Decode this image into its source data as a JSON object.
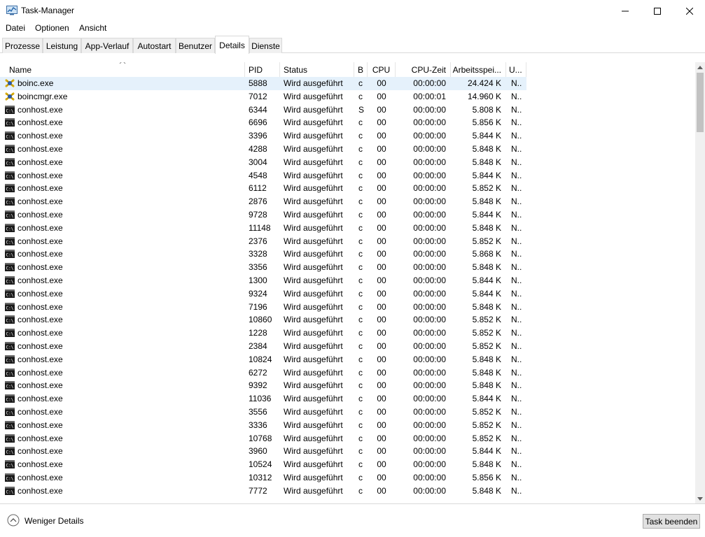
{
  "window": {
    "title": "Task-Manager",
    "icon": "task-manager-icon"
  },
  "menu": [
    "Datei",
    "Optionen",
    "Ansicht"
  ],
  "tabs": [
    {
      "label": "Prozesse",
      "active": false
    },
    {
      "label": "Leistung",
      "active": false
    },
    {
      "label": "App-Verlauf",
      "active": false
    },
    {
      "label": "Autostart",
      "active": false
    },
    {
      "label": "Benutzer",
      "active": false
    },
    {
      "label": "Details",
      "active": true
    },
    {
      "label": "Dienste",
      "active": false
    }
  ],
  "table": {
    "columns": [
      "Name",
      "PID",
      "Status",
      "B",
      "CPU",
      "CPU-Zeit",
      "Arbeitsspei...",
      "U..."
    ],
    "sorted_column": "Name",
    "rows": [
      {
        "icon": "boinc-icon",
        "name": "boinc.exe",
        "pid": "5888",
        "status": "Wird ausgeführt",
        "b": "c",
        "cpu": "00",
        "cputime": "00:00:00",
        "mem": "24.424 K",
        "u": "N..",
        "selected": true
      },
      {
        "icon": "boinc-icon",
        "name": "boincmgr.exe",
        "pid": "7012",
        "status": "Wird ausgeführt",
        "b": "c",
        "cpu": "00",
        "cputime": "00:00:01",
        "mem": "14.960 K",
        "u": "N.."
      },
      {
        "icon": "console-icon",
        "name": "conhost.exe",
        "pid": "6344",
        "status": "Wird ausgeführt",
        "b": "S",
        "cpu": "00",
        "cputime": "00:00:00",
        "mem": "5.808 K",
        "u": "N.."
      },
      {
        "icon": "console-icon",
        "name": "conhost.exe",
        "pid": "6696",
        "status": "Wird ausgeführt",
        "b": "c",
        "cpu": "00",
        "cputime": "00:00:00",
        "mem": "5.856 K",
        "u": "N.."
      },
      {
        "icon": "console-icon",
        "name": "conhost.exe",
        "pid": "3396",
        "status": "Wird ausgeführt",
        "b": "c",
        "cpu": "00",
        "cputime": "00:00:00",
        "mem": "5.844 K",
        "u": "N.."
      },
      {
        "icon": "console-icon",
        "name": "conhost.exe",
        "pid": "4288",
        "status": "Wird ausgeführt",
        "b": "c",
        "cpu": "00",
        "cputime": "00:00:00",
        "mem": "5.848 K",
        "u": "N.."
      },
      {
        "icon": "console-icon",
        "name": "conhost.exe",
        "pid": "3004",
        "status": "Wird ausgeführt",
        "b": "c",
        "cpu": "00",
        "cputime": "00:00:00",
        "mem": "5.848 K",
        "u": "N.."
      },
      {
        "icon": "console-icon",
        "name": "conhost.exe",
        "pid": "4548",
        "status": "Wird ausgeführt",
        "b": "c",
        "cpu": "00",
        "cputime": "00:00:00",
        "mem": "5.844 K",
        "u": "N.."
      },
      {
        "icon": "console-icon",
        "name": "conhost.exe",
        "pid": "6112",
        "status": "Wird ausgeführt",
        "b": "c",
        "cpu": "00",
        "cputime": "00:00:00",
        "mem": "5.852 K",
        "u": "N.."
      },
      {
        "icon": "console-icon",
        "name": "conhost.exe",
        "pid": "2876",
        "status": "Wird ausgeführt",
        "b": "c",
        "cpu": "00",
        "cputime": "00:00:00",
        "mem": "5.848 K",
        "u": "N.."
      },
      {
        "icon": "console-icon",
        "name": "conhost.exe",
        "pid": "9728",
        "status": "Wird ausgeführt",
        "b": "c",
        "cpu": "00",
        "cputime": "00:00:00",
        "mem": "5.844 K",
        "u": "N.."
      },
      {
        "icon": "console-icon",
        "name": "conhost.exe",
        "pid": "11148",
        "status": "Wird ausgeführt",
        "b": "c",
        "cpu": "00",
        "cputime": "00:00:00",
        "mem": "5.848 K",
        "u": "N.."
      },
      {
        "icon": "console-icon",
        "name": "conhost.exe",
        "pid": "2376",
        "status": "Wird ausgeführt",
        "b": "c",
        "cpu": "00",
        "cputime": "00:00:00",
        "mem": "5.852 K",
        "u": "N.."
      },
      {
        "icon": "console-icon",
        "name": "conhost.exe",
        "pid": "3328",
        "status": "Wird ausgeführt",
        "b": "c",
        "cpu": "00",
        "cputime": "00:00:00",
        "mem": "5.868 K",
        "u": "N.."
      },
      {
        "icon": "console-icon",
        "name": "conhost.exe",
        "pid": "3356",
        "status": "Wird ausgeführt",
        "b": "c",
        "cpu": "00",
        "cputime": "00:00:00",
        "mem": "5.848 K",
        "u": "N.."
      },
      {
        "icon": "console-icon",
        "name": "conhost.exe",
        "pid": "1300",
        "status": "Wird ausgeführt",
        "b": "c",
        "cpu": "00",
        "cputime": "00:00:00",
        "mem": "5.844 K",
        "u": "N.."
      },
      {
        "icon": "console-icon",
        "name": "conhost.exe",
        "pid": "9324",
        "status": "Wird ausgeführt",
        "b": "c",
        "cpu": "00",
        "cputime": "00:00:00",
        "mem": "5.844 K",
        "u": "N.."
      },
      {
        "icon": "console-icon",
        "name": "conhost.exe",
        "pid": "7196",
        "status": "Wird ausgeführt",
        "b": "c",
        "cpu": "00",
        "cputime": "00:00:00",
        "mem": "5.848 K",
        "u": "N.."
      },
      {
        "icon": "console-icon",
        "name": "conhost.exe",
        "pid": "10860",
        "status": "Wird ausgeführt",
        "b": "c",
        "cpu": "00",
        "cputime": "00:00:00",
        "mem": "5.852 K",
        "u": "N.."
      },
      {
        "icon": "console-icon",
        "name": "conhost.exe",
        "pid": "1228",
        "status": "Wird ausgeführt",
        "b": "c",
        "cpu": "00",
        "cputime": "00:00:00",
        "mem": "5.852 K",
        "u": "N.."
      },
      {
        "icon": "console-icon",
        "name": "conhost.exe",
        "pid": "2384",
        "status": "Wird ausgeführt",
        "b": "c",
        "cpu": "00",
        "cputime": "00:00:00",
        "mem": "5.852 K",
        "u": "N.."
      },
      {
        "icon": "console-icon",
        "name": "conhost.exe",
        "pid": "10824",
        "status": "Wird ausgeführt",
        "b": "c",
        "cpu": "00",
        "cputime": "00:00:00",
        "mem": "5.848 K",
        "u": "N.."
      },
      {
        "icon": "console-icon",
        "name": "conhost.exe",
        "pid": "6272",
        "status": "Wird ausgeführt",
        "b": "c",
        "cpu": "00",
        "cputime": "00:00:00",
        "mem": "5.848 K",
        "u": "N.."
      },
      {
        "icon": "console-icon",
        "name": "conhost.exe",
        "pid": "9392",
        "status": "Wird ausgeführt",
        "b": "c",
        "cpu": "00",
        "cputime": "00:00:00",
        "mem": "5.848 K",
        "u": "N.."
      },
      {
        "icon": "console-icon",
        "name": "conhost.exe",
        "pid": "11036",
        "status": "Wird ausgeführt",
        "b": "c",
        "cpu": "00",
        "cputime": "00:00:00",
        "mem": "5.844 K",
        "u": "N.."
      },
      {
        "icon": "console-icon",
        "name": "conhost.exe",
        "pid": "3556",
        "status": "Wird ausgeführt",
        "b": "c",
        "cpu": "00",
        "cputime": "00:00:00",
        "mem": "5.852 K",
        "u": "N.."
      },
      {
        "icon": "console-icon",
        "name": "conhost.exe",
        "pid": "3336",
        "status": "Wird ausgeführt",
        "b": "c",
        "cpu": "00",
        "cputime": "00:00:00",
        "mem": "5.852 K",
        "u": "N.."
      },
      {
        "icon": "console-icon",
        "name": "conhost.exe",
        "pid": "10768",
        "status": "Wird ausgeführt",
        "b": "c",
        "cpu": "00",
        "cputime": "00:00:00",
        "mem": "5.852 K",
        "u": "N.."
      },
      {
        "icon": "console-icon",
        "name": "conhost.exe",
        "pid": "3960",
        "status": "Wird ausgeführt",
        "b": "c",
        "cpu": "00",
        "cputime": "00:00:00",
        "mem": "5.844 K",
        "u": "N.."
      },
      {
        "icon": "console-icon",
        "name": "conhost.exe",
        "pid": "10524",
        "status": "Wird ausgeführt",
        "b": "c",
        "cpu": "00",
        "cputime": "00:00:00",
        "mem": "5.848 K",
        "u": "N.."
      },
      {
        "icon": "console-icon",
        "name": "conhost.exe",
        "pid": "10312",
        "status": "Wird ausgeführt",
        "b": "c",
        "cpu": "00",
        "cputime": "00:00:00",
        "mem": "5.856 K",
        "u": "N.."
      },
      {
        "icon": "console-icon",
        "name": "conhost.exe",
        "pid": "7772",
        "status": "Wird ausgeführt",
        "b": "c",
        "cpu": "00",
        "cputime": "00:00:00",
        "mem": "5.848 K",
        "u": "N.."
      }
    ]
  },
  "footer": {
    "fewer_details": "Weniger Details",
    "end_task": "Task beenden"
  },
  "colors": {
    "selected_row": "#e5f1fb",
    "tab_inactive": "#f0f0f0",
    "border": "#d9d9d9"
  }
}
